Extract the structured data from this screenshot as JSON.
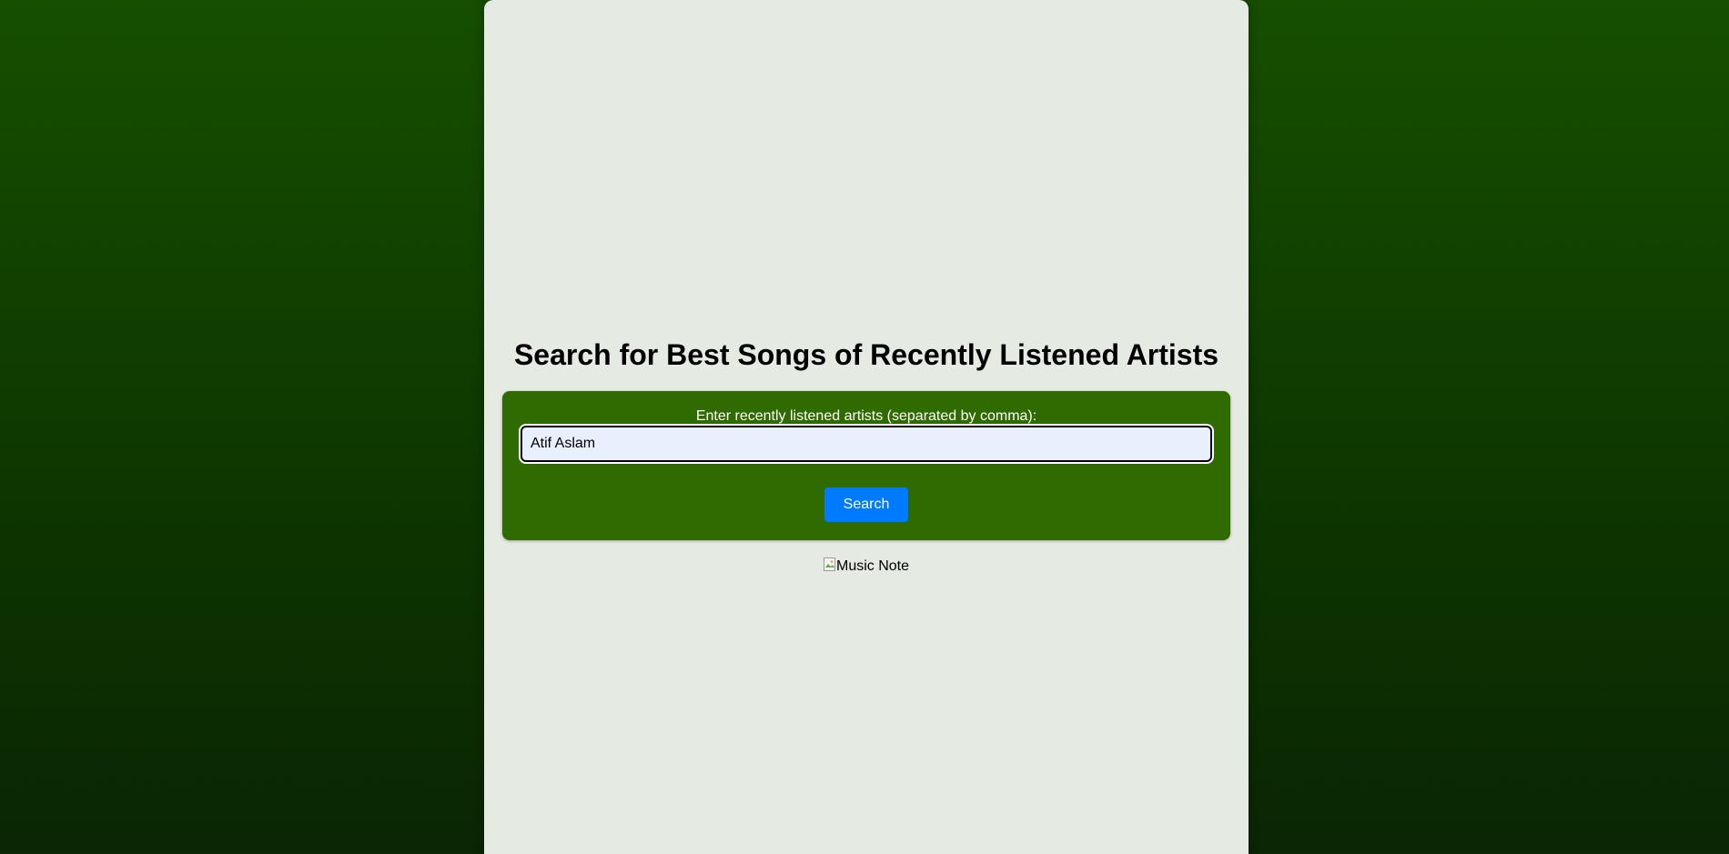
{
  "page": {
    "title": "Search for Best Songs of Recently Listened Artists"
  },
  "search_form": {
    "label": "Enter recently listened artists (separated by comma):",
    "input_value": "Atif Aslam",
    "button_label": "Search"
  },
  "image": {
    "alt_text": "Music Note",
    "icon": "broken-image-icon"
  },
  "colors": {
    "background_top": "#164f00",
    "background_bottom": "#0a2604",
    "panel": "#e5eae3",
    "form": "#2f6b00",
    "button": "#007bff",
    "input": "#e8f0fe"
  }
}
